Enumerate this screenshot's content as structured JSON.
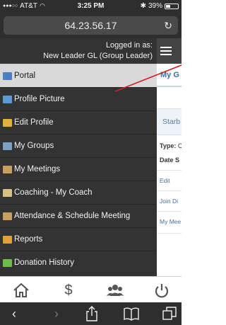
{
  "status_bar": {
    "carrier": "AT&T",
    "time": "3:25 PM",
    "bluetooth": "✱",
    "battery_text": "39%",
    "battery_level": 0.39
  },
  "browser": {
    "url": "64.23.56.17",
    "reload_icon": "reload-icon"
  },
  "menu": {
    "logged_in_line1": "Logged in as:",
    "logged_in_line2": "New Leader GL (Group Leader)",
    "items": [
      {
        "label": "Portal",
        "icon": "portal-icon",
        "color": "#4a7fc1",
        "active": true
      },
      {
        "label": "Profile Picture",
        "icon": "photo-icon",
        "color": "#5b9bd5",
        "active": false
      },
      {
        "label": "Edit Profile",
        "icon": "edit-profile-icon",
        "color": "#e0b040",
        "active": false
      },
      {
        "label": "My Groups",
        "icon": "groups-icon",
        "color": "#7aa0c8",
        "active": false
      },
      {
        "label": "My Meetings",
        "icon": "meetings-icon",
        "color": "#c9a060",
        "active": false
      },
      {
        "label": "Coaching - My Coach",
        "icon": "coach-icon",
        "color": "#d8c080",
        "active": false
      },
      {
        "label": "Attendance & Schedule Meeting",
        "icon": "attendance-icon",
        "color": "#c9a060",
        "active": false
      },
      {
        "label": "Reports",
        "icon": "reports-icon",
        "color": "#e0a040",
        "active": false
      },
      {
        "label": "Donation History",
        "icon": "donation-icon",
        "color": "#6cc04a",
        "active": false
      }
    ]
  },
  "content": {
    "title": "My G",
    "tab_label": "Starb",
    "type_label": "Type:",
    "type_value": "C",
    "date_label": "Date S",
    "edit_link": "Edit",
    "join_link": "Join Di",
    "meetings_link": "My Mee"
  },
  "app_toolbar": {
    "icons": [
      "home-icon",
      "dollar-icon",
      "people-icon",
      "power-icon"
    ]
  },
  "safari_toolbar": {
    "icons": [
      "back-icon",
      "forward-icon",
      "share-icon",
      "bookmarks-icon",
      "tabs-icon"
    ]
  }
}
